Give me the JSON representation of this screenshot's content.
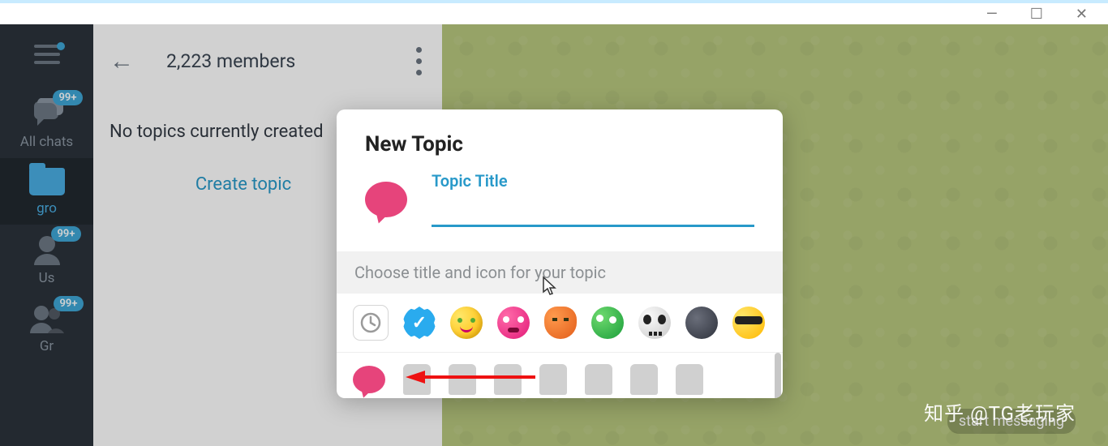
{
  "window_controls": {
    "minimize": "—",
    "maximize": "☐",
    "close": "✕"
  },
  "sidebar": {
    "items": [
      {
        "label": "All chats",
        "badge": "99+"
      },
      {
        "label": "gro"
      },
      {
        "label": "Us",
        "badge": "99+"
      },
      {
        "label": "Gr",
        "badge": "99+"
      }
    ]
  },
  "chat_header": {
    "members": "2,223 members"
  },
  "empty_state": {
    "text": "No topics currently created",
    "create": "Create topic"
  },
  "chat_area": {
    "start_messaging": "start messaging"
  },
  "modal": {
    "title": "New Topic",
    "field_label": "Topic Title",
    "choose_hint": "Choose title and icon for your topic",
    "icons": [
      "recent-icon",
      "verified-icon",
      "smile-yellow-icon",
      "smile-pink-icon",
      "pumpkin-icon",
      "blob-green-icon",
      "skull-icon",
      "moon-icon",
      "cool-icon"
    ]
  },
  "watermark": "知乎 @TG老玩家"
}
